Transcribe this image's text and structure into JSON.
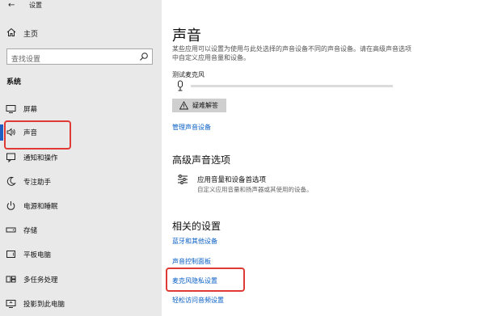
{
  "window": {
    "title": "设置"
  },
  "sidebar": {
    "home_label": "主页",
    "search_placeholder": "查找设置",
    "section_header": "系统",
    "items": [
      {
        "label": "屏幕",
        "icon": "monitor-icon"
      },
      {
        "label": "声音",
        "icon": "speaker-icon",
        "selected": true
      },
      {
        "label": "通知和操作",
        "icon": "notification-icon"
      },
      {
        "label": "专注助手",
        "icon": "moon-icon"
      },
      {
        "label": "电源和睡眠",
        "icon": "power-icon"
      },
      {
        "label": "存储",
        "icon": "storage-icon"
      },
      {
        "label": "平板电脑",
        "icon": "tablet-icon"
      },
      {
        "label": "多任务处理",
        "icon": "multitask-icon"
      },
      {
        "label": "投影到此电脑",
        "icon": "project-icon"
      }
    ]
  },
  "main": {
    "title": "声音",
    "description": "某些应用可以设置为使用与此处选择的声音设备不同的声音设备。请在高级声音选项中自定义应用音量和设备。",
    "test_mic_label": "测试麦克风",
    "troubleshoot_label": "疑难解答",
    "manage_devices_link": "管理声音设备",
    "advanced_header": "高级声音选项",
    "app_volume_title": "应用音量和设备首选项",
    "app_volume_desc": "自定义应用音量和扬声器或其使用的设备。",
    "related_header": "相关的设置",
    "related_links": [
      "蓝牙和其他设备",
      "声音控制面板",
      "麦克风隐私设置",
      "轻松访问音频设置"
    ]
  },
  "colors": {
    "accent": "#1f5fc4",
    "link": "#0a5fc4",
    "highlight_box": "#e03a36",
    "sidebar_bg": "#e9e9e9"
  }
}
